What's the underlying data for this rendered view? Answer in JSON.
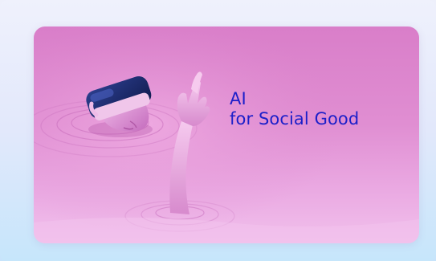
{
  "hero": {
    "title_line1": "AI",
    "title_line2": "for Social Good",
    "image_subject": "person-wearing-vr-headset-emerging-from-pink-liquid",
    "colors": {
      "title": "#1c1fc9",
      "card_top": "#d97ec9",
      "card_bottom": "#f1c0ec",
      "background_top": "#eef0fb",
      "background_bottom": "#c7e4fb"
    }
  }
}
